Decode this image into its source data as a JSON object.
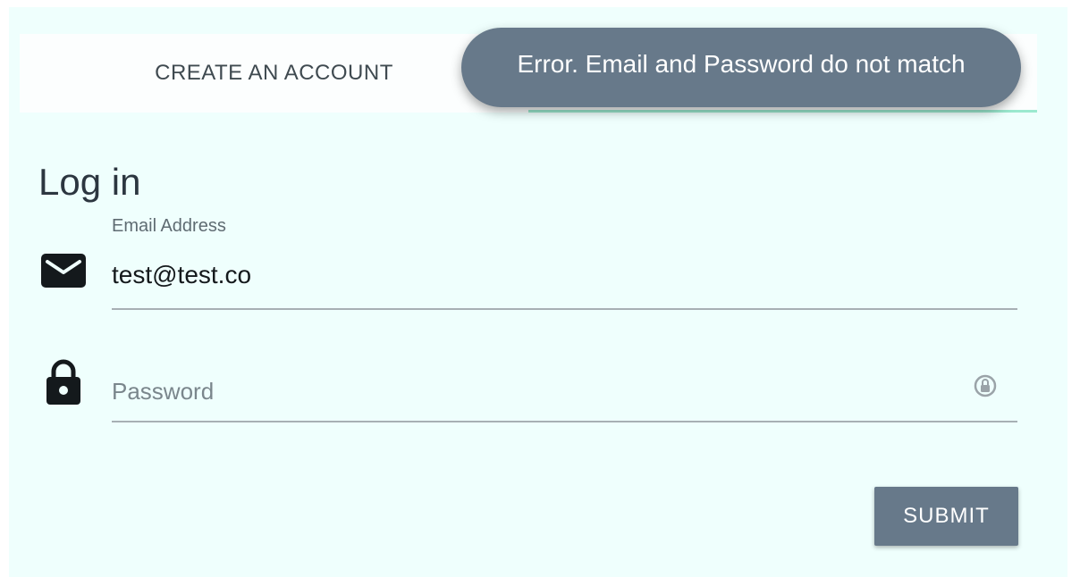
{
  "tabs": {
    "create_label": "CREATE AN ACCOUNT"
  },
  "toast": {
    "message": "Error. Email and Password do not match"
  },
  "form": {
    "heading": "Log in",
    "email_label": "Email Address",
    "email_value": "test@test.co",
    "password_placeholder": "Password",
    "submit_label": "SUBMIT"
  },
  "icons": {
    "email": "mail-icon",
    "password": "lock-icon",
    "password_manager": "password-key-icon"
  },
  "colors": {
    "accent": "#67798a",
    "background": "#effffd",
    "tab_indicator": "#9be9cf"
  }
}
